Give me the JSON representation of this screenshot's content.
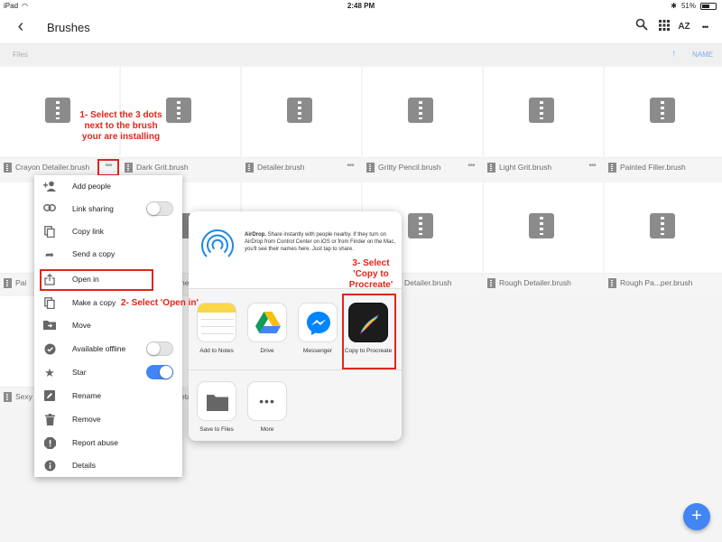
{
  "status_bar": {
    "device": "iPad",
    "time": "2:48 PM",
    "battery": "51%"
  },
  "toolbar": {
    "title": "Brushes",
    "back_icon": "chevron-left-icon",
    "sort_label": "AZ",
    "more_label": "•••"
  },
  "files_header": {
    "label": "Files",
    "sort_label": "NAME",
    "sort_arrow": "↑"
  },
  "files": [
    {
      "name": "Crayon Detailer.brush"
    },
    {
      "name": "Dark Grit.brush"
    },
    {
      "name": "Detailer.brush"
    },
    {
      "name": "Gritty Pencil.brush"
    },
    {
      "name": "Light Grit.brush"
    },
    {
      "name": "Painted Filler.brush"
    },
    {
      "name": "Pai"
    },
    {
      "name": "he"
    },
    {
      "name": ""
    },
    {
      "name": "Detailer.brush"
    },
    {
      "name": "Rough Detailer.brush"
    },
    {
      "name": "Rough Pa...per.brush"
    },
    {
      "name": "Sexy"
    },
    {
      "name": "eta"
    }
  ],
  "more_dots": "•••",
  "context_menu": {
    "items": [
      {
        "label": "Add people",
        "icon": "add-person-icon"
      },
      {
        "label": "Link sharing",
        "icon": "link-icon"
      },
      {
        "label": "Copy link",
        "icon": "copy-icon"
      },
      {
        "label": "Send a copy",
        "icon": "share-arrow-icon"
      },
      {
        "label": "Open in",
        "icon": "open-in-icon"
      },
      {
        "label": "Make a copy",
        "icon": "copy-icon"
      },
      {
        "label": "Move",
        "icon": "move-folder-icon"
      },
      {
        "label": "Available offline",
        "icon": "offline-check-icon"
      },
      {
        "label": "Star",
        "icon": "star-icon"
      },
      {
        "label": "Rename",
        "icon": "pencil-icon"
      },
      {
        "label": "Remove",
        "icon": "trash-icon"
      },
      {
        "label": "Report abuse",
        "icon": "report-icon"
      },
      {
        "label": "Details",
        "icon": "info-icon"
      }
    ],
    "link_sharing_on": false,
    "offline_on": false,
    "star_on": true
  },
  "share_sheet": {
    "airdrop_title": "AirDrop.",
    "airdrop_text": "Share instantly with people nearby. If they turn on AirDrop from Control Center on iOS or from Finder on the Mac, you'll see their names here. Just tap to share.",
    "apps": [
      {
        "label": "Add to Notes",
        "icon": "notes-icon"
      },
      {
        "label": "Drive",
        "icon": "drive-icon"
      },
      {
        "label": "Messenger",
        "icon": "messenger-icon"
      },
      {
        "label": "Copy to Procreate",
        "icon": "procreate-icon"
      }
    ],
    "actions": [
      {
        "label": "Save to Files",
        "icon": "folder-icon"
      },
      {
        "label": "More",
        "icon": "more-icon"
      }
    ]
  },
  "callouts": {
    "step1": "1- Select the 3 dots next to the brush your are installing",
    "step2": "2- Select 'Open in'",
    "step3": "3- Select 'Copy to Procreate'"
  },
  "fab_label": "+",
  "colors": {
    "accent": "#4285f4",
    "callout": "#e0261c"
  }
}
